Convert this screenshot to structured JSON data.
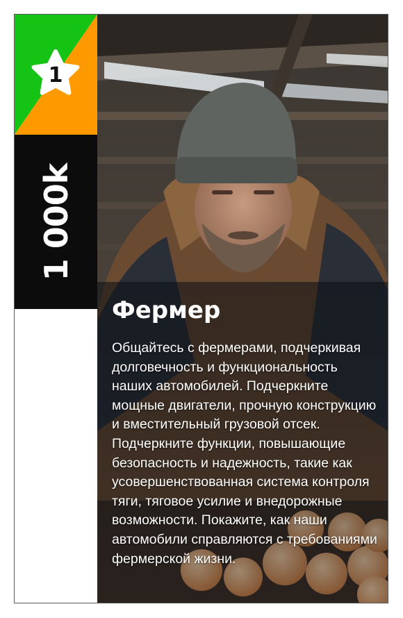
{
  "card": {
    "level": "1",
    "value": "1 000k",
    "title": "Фермер",
    "description": "Общайтесь с фермерами, подчеркивая долговечность и функциональность наших автомобилей. Подчеркните мощные двигатели, прочную конструкцию и вместительный грузовой отсек. Подчеркните функции, повышающие безопасность и надежность, такие как усовершенствованная система контроля тяги, тяговое усилие и внедорожные возможности. Покажите, как наши автомобили справляются с требованиями фермерской жизни.",
    "icon": "star-icon",
    "colors": {
      "badge_green": "#14c314",
      "badge_orange": "#ff9900",
      "value_bg": "#0c0c0c",
      "text": "#ffffff"
    }
  }
}
